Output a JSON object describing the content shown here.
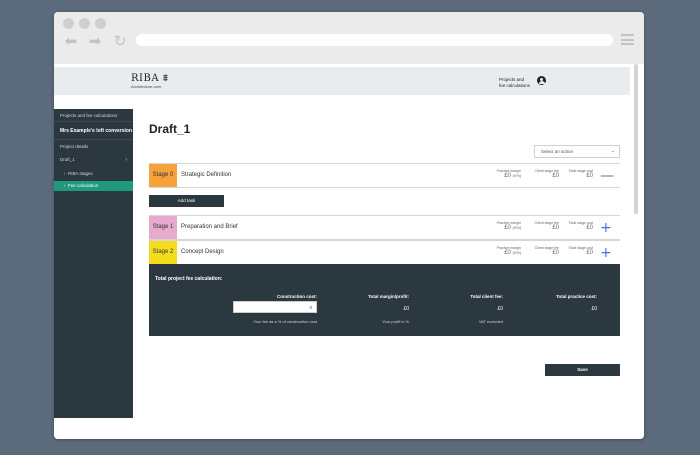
{
  "header": {
    "logo_main": "RIBA ⩩",
    "logo_sub": "Architecture.com",
    "nav_link_line1": "Projects and",
    "nav_link_line2": "fee calculations"
  },
  "sidebar": {
    "section_title": "Projects and fee calculations",
    "project_name": "Mrs Example's loft conversion",
    "project_details": "Project details",
    "draft": "Draft_1",
    "riba_stages": "RIBA stages",
    "fee_calc": "Fee calculation"
  },
  "main": {
    "title": "Draft_1",
    "select_placeholder": "Select an action",
    "add_task": "Add task",
    "save": "Save",
    "metric_labels": {
      "margin": "Practice margin",
      "client_fee": "Client stage fee",
      "stage_cost": "Total stage cost"
    },
    "stages": [
      {
        "number": "Stage 0",
        "name": "Strategic Definition",
        "color": "#f7a13c",
        "margin": "£0",
        "margin_pct": "(0%)",
        "client_fee": "£0",
        "stage_cost": "£0",
        "toggle": "—"
      },
      {
        "number": "Stage 1",
        "name": "Preparation and Brief",
        "color": "#e8a9cf",
        "margin": "£0",
        "margin_pct": "(0%)",
        "client_fee": "£0",
        "stage_cost": "£0",
        "toggle": "+"
      },
      {
        "number": "Stage 2",
        "name": "Concept Design",
        "color": "#f4dc1c",
        "margin": "£0",
        "margin_pct": "(0%)",
        "client_fee": "£0",
        "stage_cost": "£0",
        "toggle": "+"
      }
    ],
    "totals": {
      "title": "Total project fee calculation:",
      "construction_label": "Construction cost:",
      "construction_value": "0",
      "construction_note": "Your fee as a % of construction cost",
      "margin_label": "Total margin/profit:",
      "margin_value": "£0",
      "margin_note": "Your profit is %",
      "client_fee_label": "Total client fee:",
      "client_fee_value": "£0",
      "client_fee_note": "VAT excluded",
      "practice_cost_label": "Total practice cost:",
      "practice_cost_value": "£0"
    }
  }
}
